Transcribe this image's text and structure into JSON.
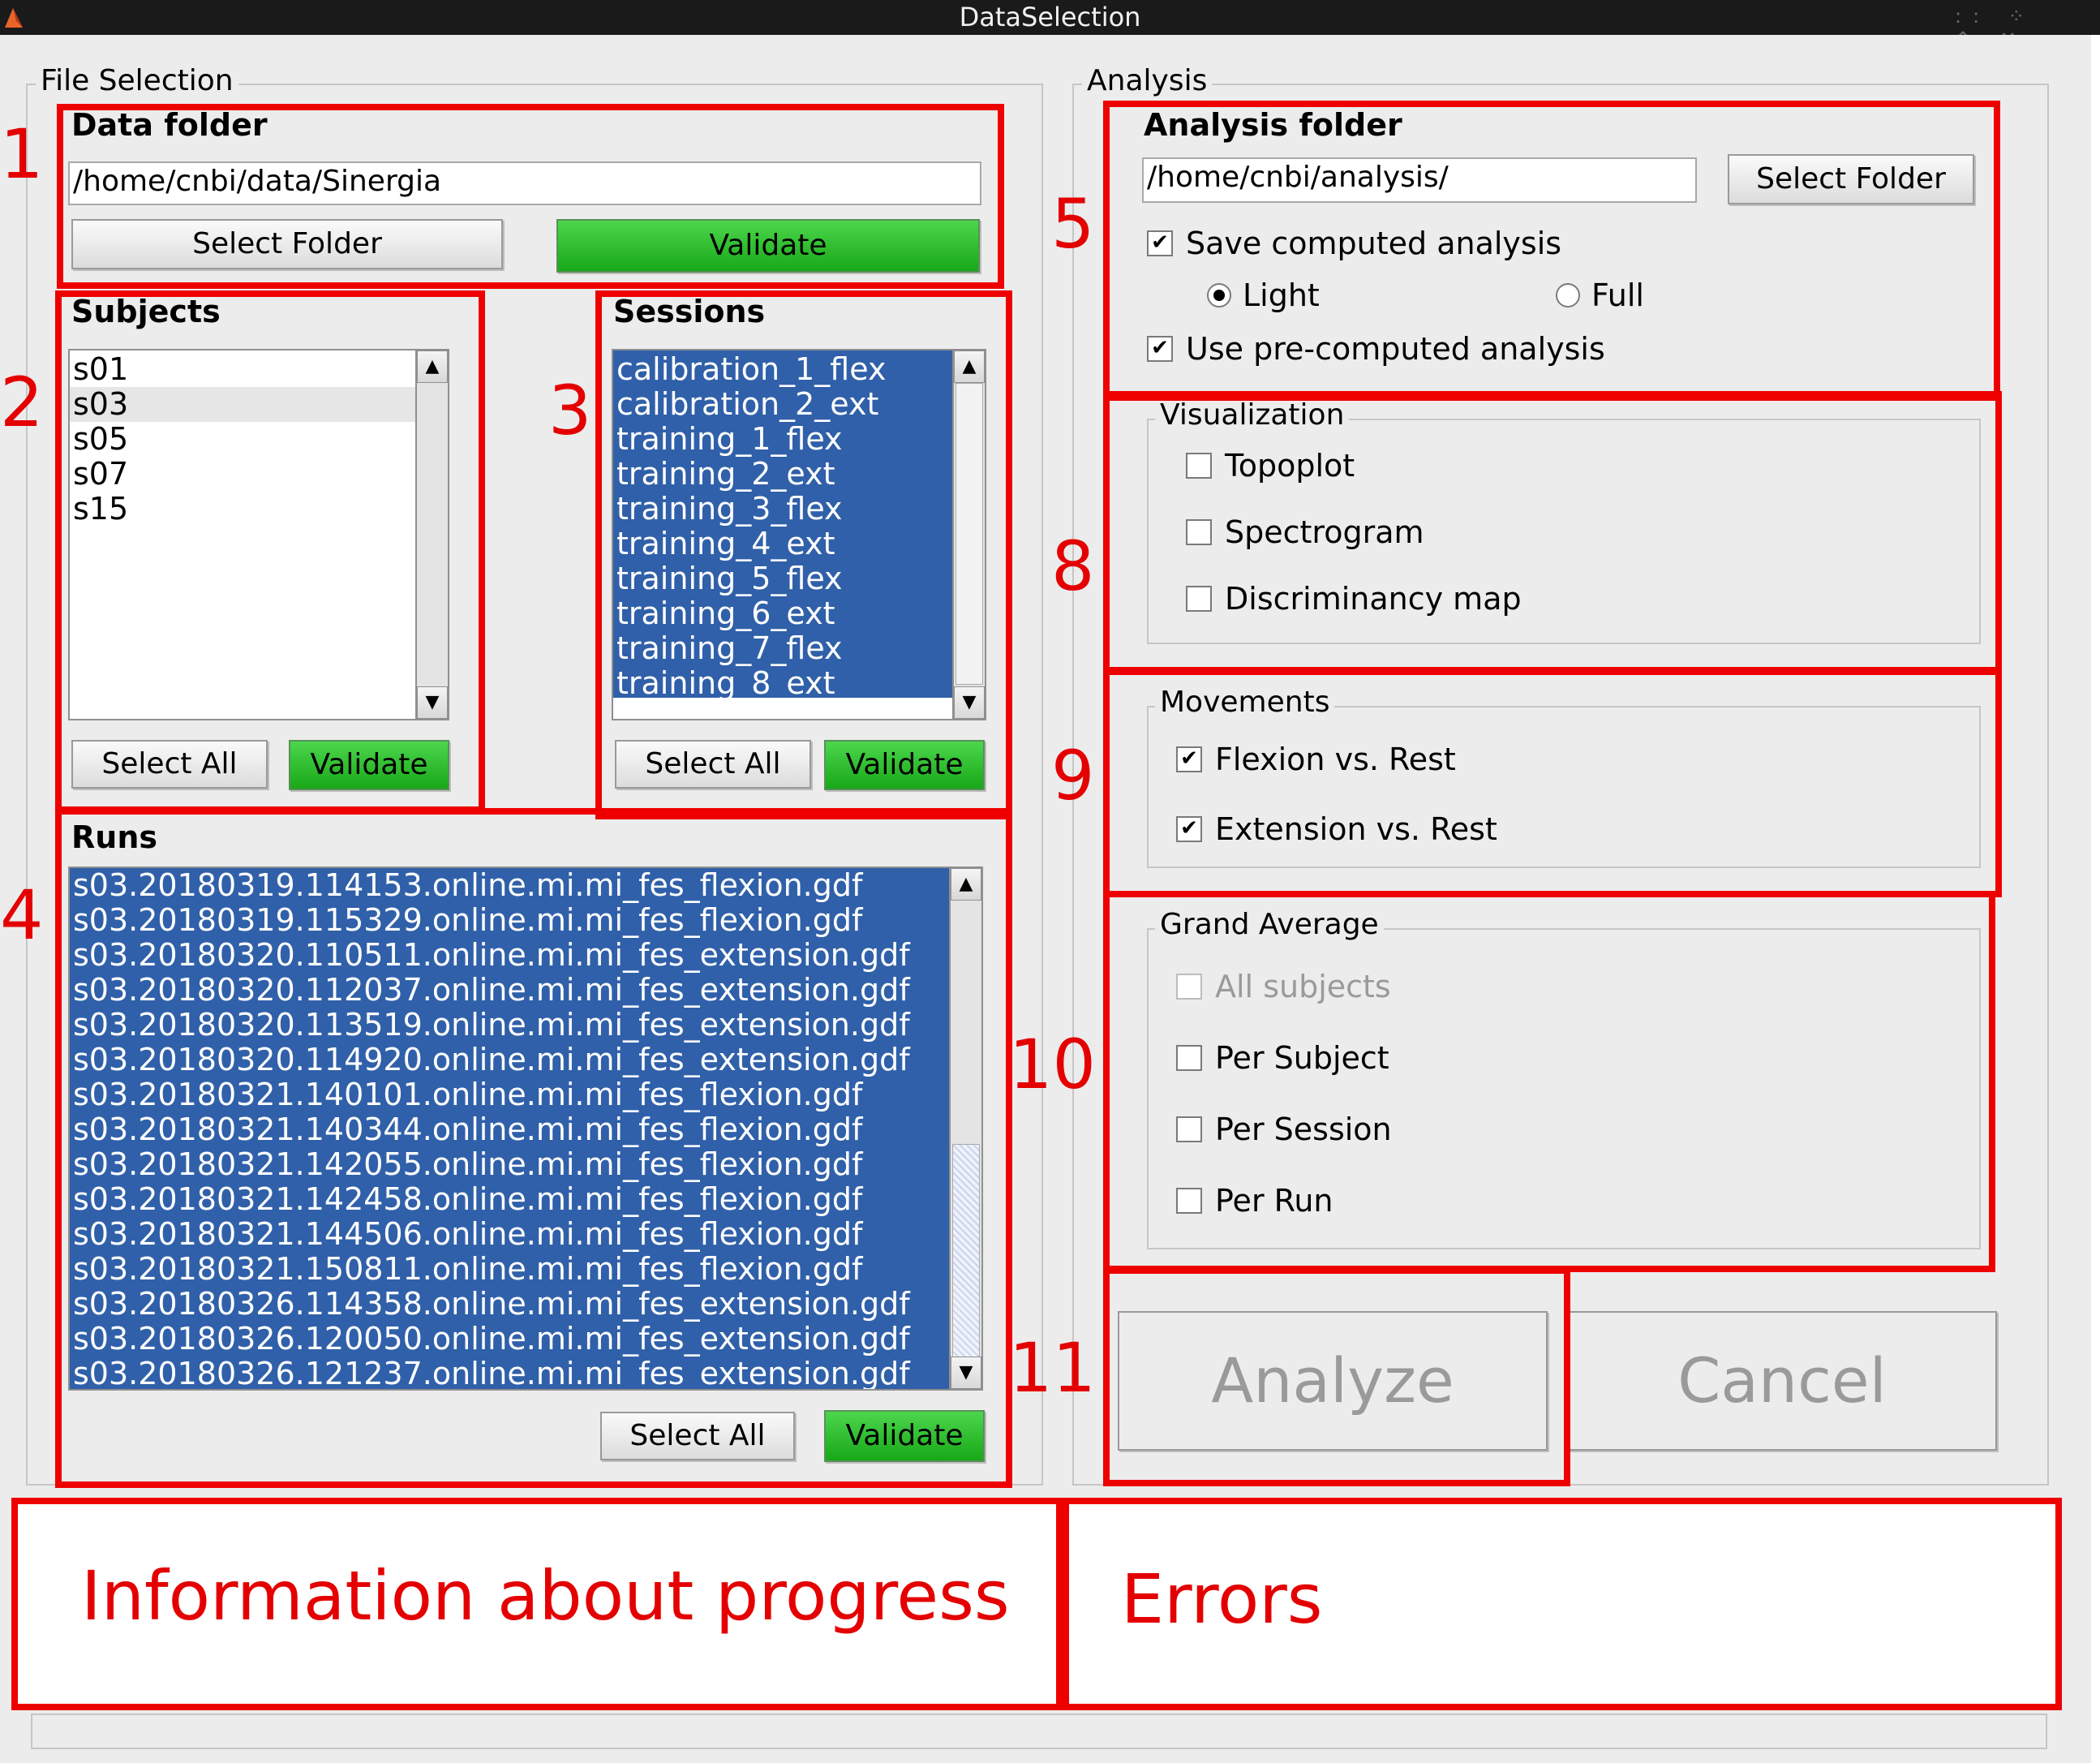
{
  "window": {
    "title": "DataSelection"
  },
  "file_selection": {
    "label": "File Selection",
    "data_folder": {
      "header": "Data folder",
      "path": "/home/cnbi/data/Sinergia",
      "select_label": "Select Folder",
      "validate_label": "Validate"
    },
    "subjects": {
      "header": "Subjects",
      "items": [
        "s01",
        "s03",
        "s05",
        "s07",
        "s15"
      ],
      "highlighted": "s03",
      "select_all_label": "Select All",
      "validate_label": "Validate"
    },
    "sessions": {
      "header": "Sessions",
      "items": [
        "calibration_1_flex",
        "calibration_2_ext",
        "training_1_flex",
        "training_2_ext",
        "training_3_flex",
        "training_4_ext",
        "training_5_flex",
        "training_6_ext",
        "training_7_flex",
        "training_8_ext"
      ],
      "select_all_label": "Select All",
      "validate_label": "Validate"
    },
    "runs": {
      "header": "Runs",
      "items": [
        "s03.20180319.114153.online.mi.mi_fes_flexion.gdf",
        "s03.20180319.115329.online.mi.mi_fes_flexion.gdf",
        "s03.20180320.110511.online.mi.mi_fes_extension.gdf",
        "s03.20180320.112037.online.mi.mi_fes_extension.gdf",
        "s03.20180320.113519.online.mi.mi_fes_extension.gdf",
        "s03.20180320.114920.online.mi.mi_fes_extension.gdf",
        "s03.20180321.140101.online.mi.mi_fes_flexion.gdf",
        "s03.20180321.140344.online.mi.mi_fes_flexion.gdf",
        "s03.20180321.142055.online.mi.mi_fes_flexion.gdf",
        "s03.20180321.142458.online.mi.mi_fes_flexion.gdf",
        "s03.20180321.144506.online.mi.mi_fes_flexion.gdf",
        "s03.20180321.150811.online.mi.mi_fes_flexion.gdf",
        "s03.20180326.114358.online.mi.mi_fes_extension.gdf",
        "s03.20180326.120050.online.mi.mi_fes_extension.gdf",
        "s03.20180326.121237.online.mi.mi_fes_extension.gdf"
      ],
      "select_all_label": "Select All",
      "validate_label": "Validate"
    }
  },
  "analysis": {
    "label": "Analysis",
    "folder_header": "Analysis folder",
    "path": "/home/cnbi/analysis/",
    "select_label": "Select Folder",
    "save_computed": {
      "label": "Save computed analysis",
      "checked": true
    },
    "mode": {
      "light_label": "Light",
      "full_label": "Full",
      "selected": "Light"
    },
    "use_precomputed": {
      "label": "Use pre-computed analysis",
      "checked": true
    },
    "visualization": {
      "label": "Visualization",
      "topoplot": "Topoplot",
      "spectrogram": "Spectrogram",
      "discriminancy": "Discriminancy map"
    },
    "movements": {
      "label": "Movements",
      "flexion": "Flexion vs. Rest",
      "extension": "Extension vs. Rest"
    },
    "grand_average": {
      "label": "Grand Average",
      "all_subjects": "All subjects",
      "per_subject": "Per Subject",
      "per_session": "Per Session",
      "per_run": "Per Run"
    },
    "analyze_label": "Analyze",
    "cancel_label": "Cancel"
  },
  "annotations": {
    "n1": "1",
    "n2": "2",
    "n3": "3",
    "n4": "4",
    "n5": "5",
    "n8": "8",
    "n9": "9",
    "n10": "10",
    "n11": "11",
    "progress": "Information about progress",
    "errors": "Errors"
  },
  "colors": {
    "selection": "#3060a9",
    "validate": "#22b322",
    "annotation": "#ee0000"
  }
}
